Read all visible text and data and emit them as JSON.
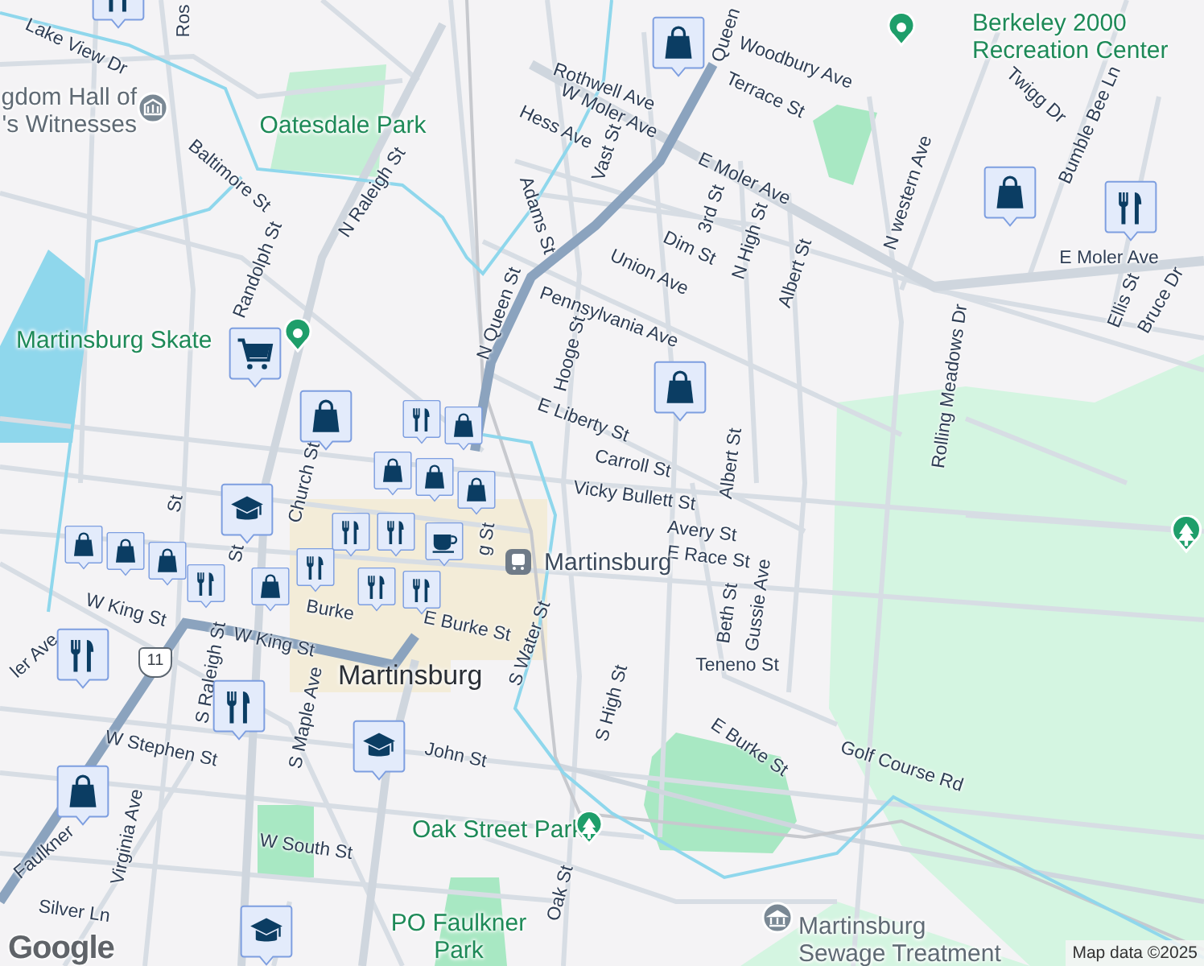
{
  "map": {
    "street_labels": [
      "Lake View Dr",
      "Ros",
      "Baltimore St",
      "Randolph St",
      "N Raleigh St",
      "Hess Ave",
      "W Moler Ave",
      "Rothwell Ave",
      "Woodbury Ave",
      "Terrace St",
      "Queen",
      "Adams St",
      "Vast St",
      "E Moler Ave",
      "3rd St",
      "Dim St",
      "Union Ave",
      "N High St",
      "Albert St",
      "N western Ave",
      "Twigg Dr",
      "Bumble Bee Ln",
      "E Moler Ave",
      "Ellis St",
      "Bruce Dr",
      "Rolling Meadows Dr",
      "N Queen St",
      "Pennsylvania Ave",
      "Hooge St",
      "E Liberty St",
      "Carroll St",
      "Albert St",
      "Vicky Bullett St",
      "Avery St",
      "E Race St",
      "Beth St",
      "Gussie Ave",
      "Teneno St",
      "E Burke St",
      "Golf Course Rd",
      "S High St",
      "S Water St",
      "E Burke St",
      "Burke",
      "W King St",
      "W King St",
      "Church St",
      "S Raleigh St",
      "S Maple Ave",
      "Virginia Ave",
      "W Stephen St",
      "John St",
      "W South St",
      "Silver Ln",
      "Faulkner",
      "ler Ave",
      "Oak St",
      "St",
      "St",
      "g St"
    ],
    "places": [
      {
        "kind": "worship",
        "lines": [
          "gdom Hall of",
          "'s Witnesses"
        ]
      },
      {
        "kind": "park",
        "lines": [
          "Oatesdale Park"
        ]
      },
      {
        "kind": "recreation",
        "lines": [
          "Martinsburg Skate"
        ]
      },
      {
        "kind": "recreation",
        "lines": [
          "Berkeley 2000",
          "Recreation Center"
        ]
      },
      {
        "kind": "transit",
        "lines": [
          "Martinsburg"
        ]
      },
      {
        "kind": "park_tree",
        "lines": [
          "Oak Street Park"
        ]
      },
      {
        "kind": "park",
        "lines": [
          "PO Faulkner",
          "Park"
        ]
      },
      {
        "kind": "utility",
        "lines": [
          "Martinsburg",
          "Sewage Treatment"
        ]
      }
    ],
    "city_label": "Martinsburg",
    "route_shield": "11",
    "markers": [
      {
        "kind": "restaurant"
      },
      {
        "kind": "shopping"
      },
      {
        "kind": "shopping"
      },
      {
        "kind": "restaurant"
      },
      {
        "kind": "cart"
      },
      {
        "kind": "shopping"
      },
      {
        "kind": "shopping"
      },
      {
        "kind": "restaurant"
      },
      {
        "kind": "shopping"
      },
      {
        "kind": "shopping"
      },
      {
        "kind": "shopping"
      },
      {
        "kind": "school"
      },
      {
        "kind": "shopping"
      },
      {
        "kind": "shopping"
      },
      {
        "kind": "shopping"
      },
      {
        "kind": "restaurant"
      },
      {
        "kind": "restaurant"
      },
      {
        "kind": "shopping"
      },
      {
        "kind": "restaurant"
      },
      {
        "kind": "shopping"
      },
      {
        "kind": "restaurant"
      },
      {
        "kind": "restaurant"
      },
      {
        "kind": "cafe"
      },
      {
        "kind": "restaurant"
      },
      {
        "kind": "restaurant"
      },
      {
        "kind": "restaurant"
      },
      {
        "kind": "school"
      },
      {
        "kind": "shopping"
      },
      {
        "kind": "school"
      },
      {
        "kind": "tree_pin"
      }
    ],
    "logo": "Google",
    "attribution": "Map data ©2025"
  }
}
